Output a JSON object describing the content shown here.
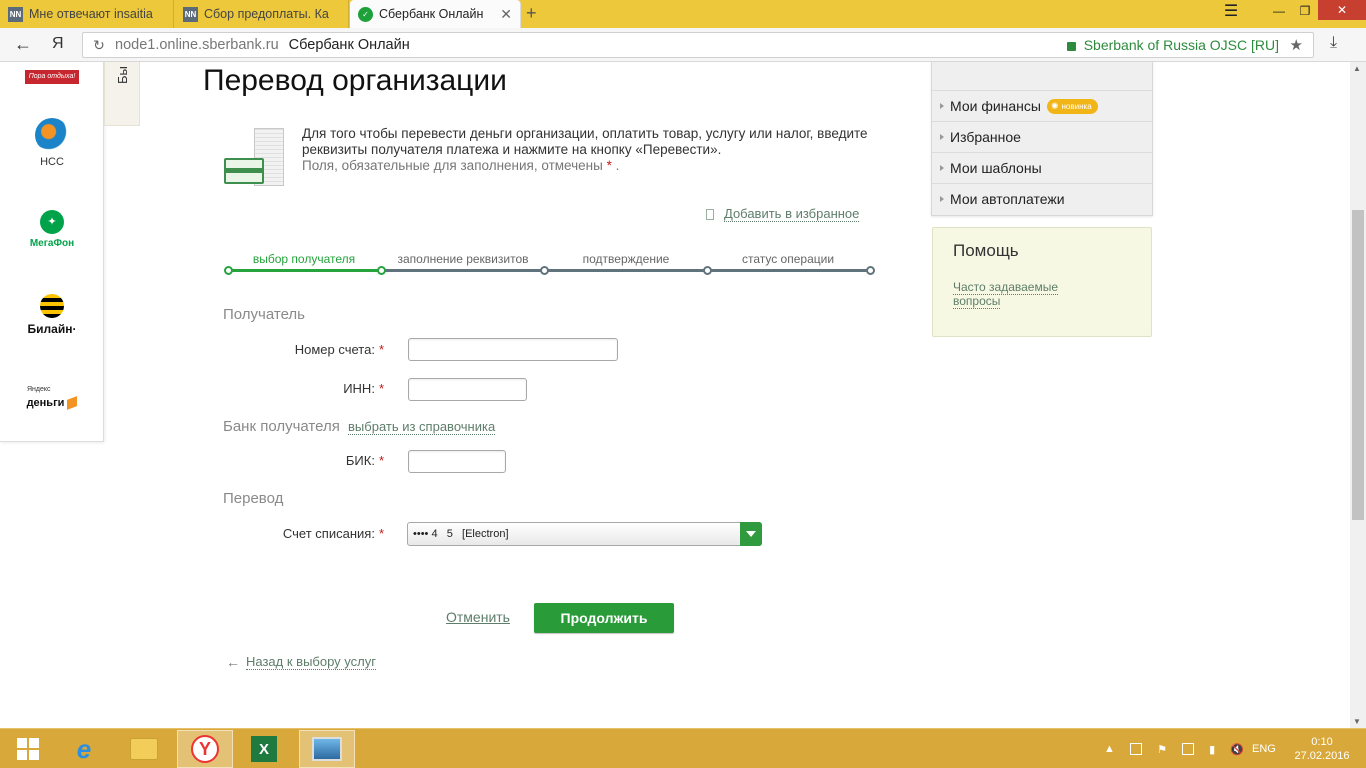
{
  "browser": {
    "tabs": [
      {
        "favicon": "NN",
        "label": "Мне отвечают insaitia"
      },
      {
        "favicon": "NN",
        "label": "Сбор предоплаты. Ка"
      },
      {
        "favicon": "sberbank-icon",
        "label": "Сбербанк Онлайн",
        "active": true
      }
    ],
    "new_tab": "+",
    "nav_back": "←",
    "yandex": "Я",
    "url_domain": "node1.online.sberbank.ru",
    "url_title": "Сбербанк Онлайн",
    "certificate": "Sberbank of Russia OJSC [RU]"
  },
  "left_panel": {
    "tab_label": "Бы",
    "logos": [
      {
        "name": "red-brand",
        "text": "Пора отдыха!"
      },
      {
        "name": "nss",
        "text": "НСС"
      },
      {
        "name": "megafon",
        "text": "МегаФон"
      },
      {
        "name": "beeline",
        "text": "Билайн·"
      },
      {
        "name": "yandex-money",
        "text_top": "Яндекс",
        "text": "деньги"
      }
    ]
  },
  "main": {
    "title": "Перевод организации",
    "intro": "Для того чтобы перевести деньги организации, оплатить товар, услугу или налог, введите реквизиты получателя платежа и нажмите на кнопку «Перевести».",
    "required_note": "Поля, обязательные для заполнения, отмечены",
    "required_star": "*",
    "add_favorite": "Добавить в избранное",
    "steps": [
      {
        "label": "выбор получателя",
        "state": "done"
      },
      {
        "label": "заполнение реквизитов",
        "state": "pending"
      },
      {
        "label": "подтверждение",
        "state": "pending"
      },
      {
        "label": "статус операции",
        "state": "pending"
      }
    ],
    "sections": {
      "recipient": "Получатель",
      "bank": "Банк получателя",
      "bank_link": "выбрать из справочника",
      "transfer": "Перевод"
    },
    "fields": {
      "account_label": "Номер счета:",
      "account_value": "",
      "inn_label": "ИНН:",
      "inn_value": "",
      "bik_label": "БИК:",
      "bik_value": "",
      "debit_label": "Счет списания:",
      "debit_value": "•••• 4   5   [Electron]"
    },
    "cancel": "Отменить",
    "continue": "Продолжить",
    "back": "Назад к выбору услуг"
  },
  "sidebar": {
    "menu": [
      {
        "label": "Мои финансы",
        "badge": "новинка"
      },
      {
        "label": "Избранное"
      },
      {
        "label": "Мои шаблоны"
      },
      {
        "label": "Мои автоплатежи"
      }
    ],
    "help_title": "Помощь",
    "help_link": "Часто задаваемые вопросы"
  },
  "taskbar": {
    "apps": [
      "windows-start",
      "internet-explorer",
      "file-explorer",
      "yandex-browser",
      "excel",
      "photo-viewer"
    ],
    "language": "ENG",
    "time": "0:10",
    "date": "27.02.2016"
  },
  "colors": {
    "accent_green": "#2a9b39",
    "link_green": "#5e7d6a",
    "required_red": "#c21a1a",
    "tabbar_yellow": "#ecc83a",
    "taskbar_orange": "#d9a83a"
  }
}
